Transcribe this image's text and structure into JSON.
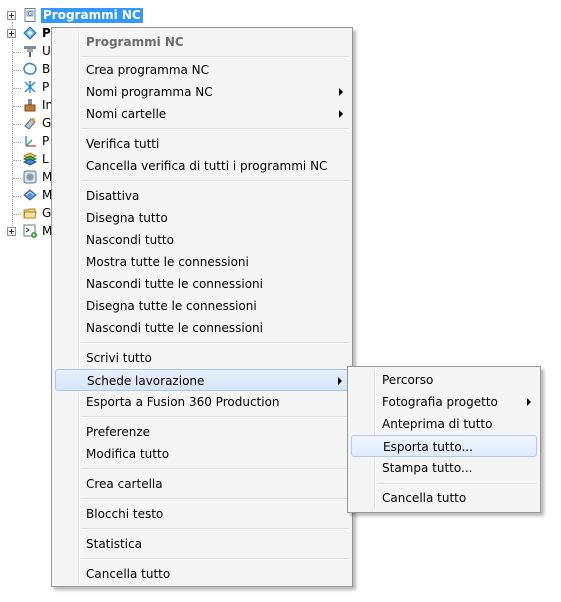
{
  "tree": {
    "items": [
      {
        "label": "Programmi NC",
        "icon": "nc-programs-icon"
      },
      {
        "label": "P",
        "icon": "toolpaths-icon"
      },
      {
        "label": "U",
        "icon": "tools-icon"
      },
      {
        "label": "B",
        "icon": "boundaries-icon"
      },
      {
        "label": "P",
        "icon": "patterns-icon"
      },
      {
        "label": "In",
        "icon": "stock-icon"
      },
      {
        "label": "G",
        "icon": "tool-holder-icon"
      },
      {
        "label": "P",
        "icon": "workplanes-icon"
      },
      {
        "label": "L",
        "icon": "levels-icon"
      },
      {
        "label": "M",
        "icon": "models-icon"
      },
      {
        "label": "M",
        "icon": "machines-icon"
      },
      {
        "label": "G",
        "icon": "groups-icon"
      },
      {
        "label": "M",
        "icon": "macros-icon"
      }
    ]
  },
  "context_menu": {
    "header": "Programmi NC",
    "items": [
      {
        "label": "Crea programma NC"
      },
      {
        "label": "Nomi programma NC"
      },
      {
        "label": "Nomi cartelle"
      },
      {
        "label": "Verifica tutti"
      },
      {
        "label": "Cancella verifica di tutti i programmi NC"
      },
      {
        "label": "Disattiva"
      },
      {
        "label": "Disegna tutto"
      },
      {
        "label": "Nascondi tutto"
      },
      {
        "label": "Mostra tutte le connessioni"
      },
      {
        "label": "Nascondi tutte le connessioni"
      },
      {
        "label": "Disegna tutte le connessioni"
      },
      {
        "label": "Nascondi tutte le connessioni"
      },
      {
        "label": "Scrivi tutto"
      },
      {
        "label": "Schede lavorazione"
      },
      {
        "label": "Esporta a Fusion 360 Production"
      },
      {
        "label": "Preferenze"
      },
      {
        "label": "Modifica tutto"
      },
      {
        "label": "Crea cartella"
      },
      {
        "label": "Blocchi testo"
      },
      {
        "label": "Statistica"
      },
      {
        "label": "Cancella tutto"
      }
    ]
  },
  "submenu": {
    "items": [
      {
        "label": "Percorso"
      },
      {
        "label": "Fotografia progetto"
      },
      {
        "label": "Anteprima di tutto"
      },
      {
        "label": "Esporta tutto..."
      },
      {
        "label": "Stampa tutto..."
      },
      {
        "label": "Cancella tutto"
      }
    ]
  },
  "colors": {
    "selection": "#3399ff",
    "menu_background": "#f5f5f5",
    "menu_border": "#979797",
    "highlight_border": "#a8c8ed"
  }
}
